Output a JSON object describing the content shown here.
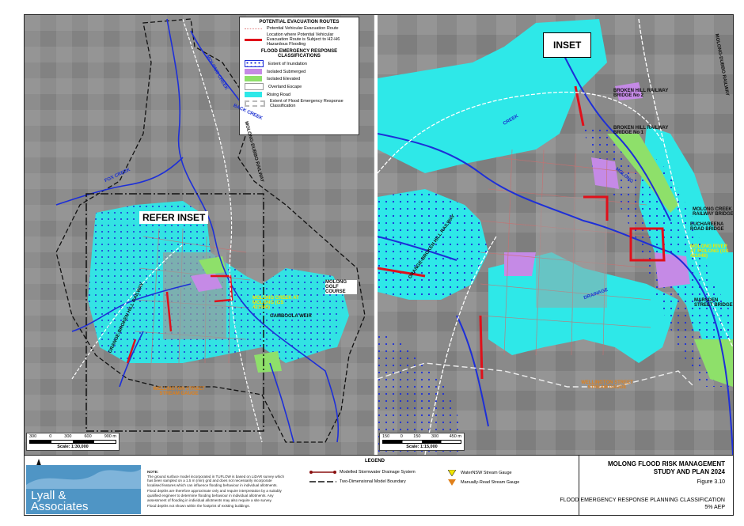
{
  "colors": {
    "rising_road": "#2ee8e8",
    "isolated_submerged": "#c58ae6",
    "isolated_elevated": "#8ee06a",
    "inundation": "#1d2fd8",
    "hazard_route": "#e0101a",
    "evac_route": "#e08080",
    "background": "#8c8c8c"
  },
  "legend_top": {
    "header1": "POTENTIAL EVACUATION ROUTES",
    "evac_route": "Potential Vehicular Evacuation Route",
    "hazard_route": "Location where Potential Vehicular Evacuation Route is Subject to H2-H6 Hazardous Flooding",
    "header2": "FLOOD EMERGENCY RESPONSE CLASSIFICATIONS",
    "items": [
      {
        "label": "Extent of Inundation",
        "icon": "dotted-blue"
      },
      {
        "label": "Isolated Submerged",
        "icon": "purple-fill"
      },
      {
        "label": "Isolated Elevated",
        "icon": "green-fill"
      },
      {
        "label": "Overland Escape",
        "icon": "white-fill"
      },
      {
        "label": "Rising Road",
        "icon": "cyan-fill"
      },
      {
        "label": "Extent of Flood Emergency Response Classification",
        "icon": "grey-dash"
      }
    ]
  },
  "map_left": {
    "refer_inset": "REFER INSET",
    "labels": [
      {
        "t": "BACK CREEK",
        "c": "blue"
      },
      {
        "t": "MOLONG CREEK",
        "c": "blue"
      },
      {
        "t": "FOX CREEK",
        "c": "blue"
      },
      {
        "t": "GAMBOOLA WEIR",
        "c": "black"
      },
      {
        "t": "MOLONG GOLF COURSE",
        "c": "black"
      },
      {
        "t": "MOLONG CREEK AT MOLONG (GS 421048)",
        "c": "yellow"
      },
      {
        "t": "WELLINGTON STREET STREAM GAUGE",
        "c": "orange"
      },
      {
        "t": "MOLONG-DUBBO RAILWAY",
        "c": "black"
      },
      {
        "t": "ORANGE-BROKEN HILL RAILWAY",
        "c": "black"
      }
    ],
    "scale": {
      "ticks": [
        "300",
        "0",
        "300",
        "600",
        "900 m"
      ],
      "caption": "Scale: 1:30,000"
    }
  },
  "map_right": {
    "inset_title": "INSET",
    "labels": [
      {
        "t": "BROKEN HILL RAILWAY BRIDGE No 2",
        "c": "black"
      },
      {
        "t": "BROKEN HILL RAILWAY BRIDGE No 1",
        "c": "black"
      },
      {
        "t": "MOLONG CREEK RAILWAY BRIDGE",
        "c": "black"
      },
      {
        "t": "EUCHAREENA ROAD BRIDGE",
        "c": "black"
      },
      {
        "t": "MOLONG RIVER AT MOLONG (GS 421048)",
        "c": "yellow"
      },
      {
        "t": "MARSDEN STREET BRIDGE",
        "c": "black"
      },
      {
        "t": "WELLINGTON STREET STREAM GAUGE",
        "c": "orange"
      },
      {
        "t": "MOLONG-DUBBO RAILWAY",
        "c": "black"
      },
      {
        "t": "ORANGE-BROKEN HILL RAILWAY",
        "c": "black"
      },
      {
        "t": "DRAINAGE",
        "c": "blue"
      },
      {
        "t": "CREEK",
        "c": "blue"
      },
      {
        "t": "MOLONG",
        "c": "blue"
      }
    ],
    "scale": {
      "ticks": [
        "150",
        "0",
        "150",
        "300",
        "450 m"
      ],
      "caption": "Scale: 1:15,000"
    }
  },
  "bottom": {
    "logo_line1": "Lyall &",
    "logo_line2": "Associates",
    "north": "N",
    "note_title": "NOTE:",
    "note_1": "The ground surface model incorporated in TUFLOW is based on LiDAR survey which has been sampled on a 1.5 m (min) grid and does not necessarily incorporate localised features which can influence flooding behaviour in individual allotments.",
    "note_2": "Flood depths are therefore approximate only and require interpretation by a suitably qualified engineer to determine flooding behaviour in individual allotments. Any assessment of flooding in individual allotments may also require a site survey.",
    "note_3": "Flood depths not shown within the footprint of existing buildings.",
    "legend_title": "LEGEND",
    "legend": {
      "stormwater": "Modelled Stormwater Drainage System",
      "boundary": "Two-Dimensional Model Boundary",
      "nsw_gauge": "WaterNSW Stream Gauge",
      "manual_gauge": "Manually-Read Stream Gauge"
    },
    "title1": "MOLONG FLOOD RISK MANAGEMENT",
    "title2": "STUDY AND PLAN 2024",
    "figure": "Figure 3.10",
    "subtitle1": "FLOOD EMERGENCY RESPONSE PLANNING CLASSIFICATION",
    "subtitle2": "5% AEP"
  }
}
